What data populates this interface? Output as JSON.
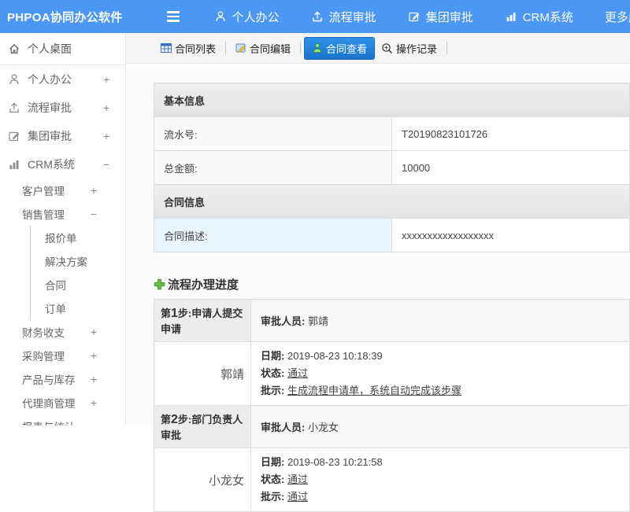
{
  "header": {
    "logo": "PHPOA协同办公软件",
    "menu": [
      {
        "label": "个人办公"
      },
      {
        "label": "流程审批"
      },
      {
        "label": "集团审批"
      },
      {
        "label": "CRM系统"
      },
      {
        "label": "更多应用"
      }
    ]
  },
  "sidebar": {
    "items": [
      {
        "label": "个人桌面"
      },
      {
        "label": "个人办公",
        "expand": "+"
      },
      {
        "label": "流程审批",
        "expand": "+"
      },
      {
        "label": "集团审批",
        "expand": "+"
      },
      {
        "label": "CRM系统",
        "expand": "−"
      },
      {
        "label": "客户管理",
        "expand": "+"
      },
      {
        "label": "销售管理",
        "expand": "−"
      },
      {
        "label": "报价单"
      },
      {
        "label": "解决方案"
      },
      {
        "label": "合同"
      },
      {
        "label": "订单"
      },
      {
        "label": "财务收支",
        "expand": "+"
      },
      {
        "label": "采购管理",
        "expand": "+"
      },
      {
        "label": "产品与库存",
        "expand": "+"
      },
      {
        "label": "代理商管理",
        "expand": "+"
      },
      {
        "label": "报表与统计"
      }
    ]
  },
  "tabs": [
    {
      "label": "合同列表"
    },
    {
      "label": "合同编辑"
    },
    {
      "label": "合同查看"
    },
    {
      "label": "操作记录"
    }
  ],
  "info_table": {
    "section1_title": "基本信息",
    "rows1": [
      {
        "label": "流水号:",
        "value": "T20190823101726"
      },
      {
        "label": "总金额:",
        "value": "10000"
      }
    ],
    "section2_title": "合同信息",
    "rows2": [
      {
        "label": "合同描述:",
        "value": "xxxxxxxxxxxxxxxxxx"
      }
    ]
  },
  "progress": {
    "title": "流程办理进度",
    "approver_label": "审批人员:",
    "date_label": "日期:",
    "status_label": "状态:",
    "comment_label": "批示:",
    "steps": [
      {
        "prefix": "第",
        "num": "1",
        "suffix": "步:申请人提交申请",
        "approver": "郭靖",
        "name": "郭靖",
        "date": "2019-08-23 10:18:39",
        "status": "通过",
        "comment": "生成流程申请单，系统自动完成该步骤"
      },
      {
        "prefix": "第",
        "num": "2",
        "suffix": "步:部门负责人审批",
        "approver": "小龙女",
        "name": "小龙女",
        "date": "2019-08-23 10:21:58",
        "status": "通过",
        "comment": "通过"
      }
    ]
  },
  "colors": {
    "header_blue": "#4a98f4",
    "active_tab_blue": "#1e82d2",
    "contract_label_bg": "#e9f4fc",
    "plus_green": "#6abf4b"
  }
}
